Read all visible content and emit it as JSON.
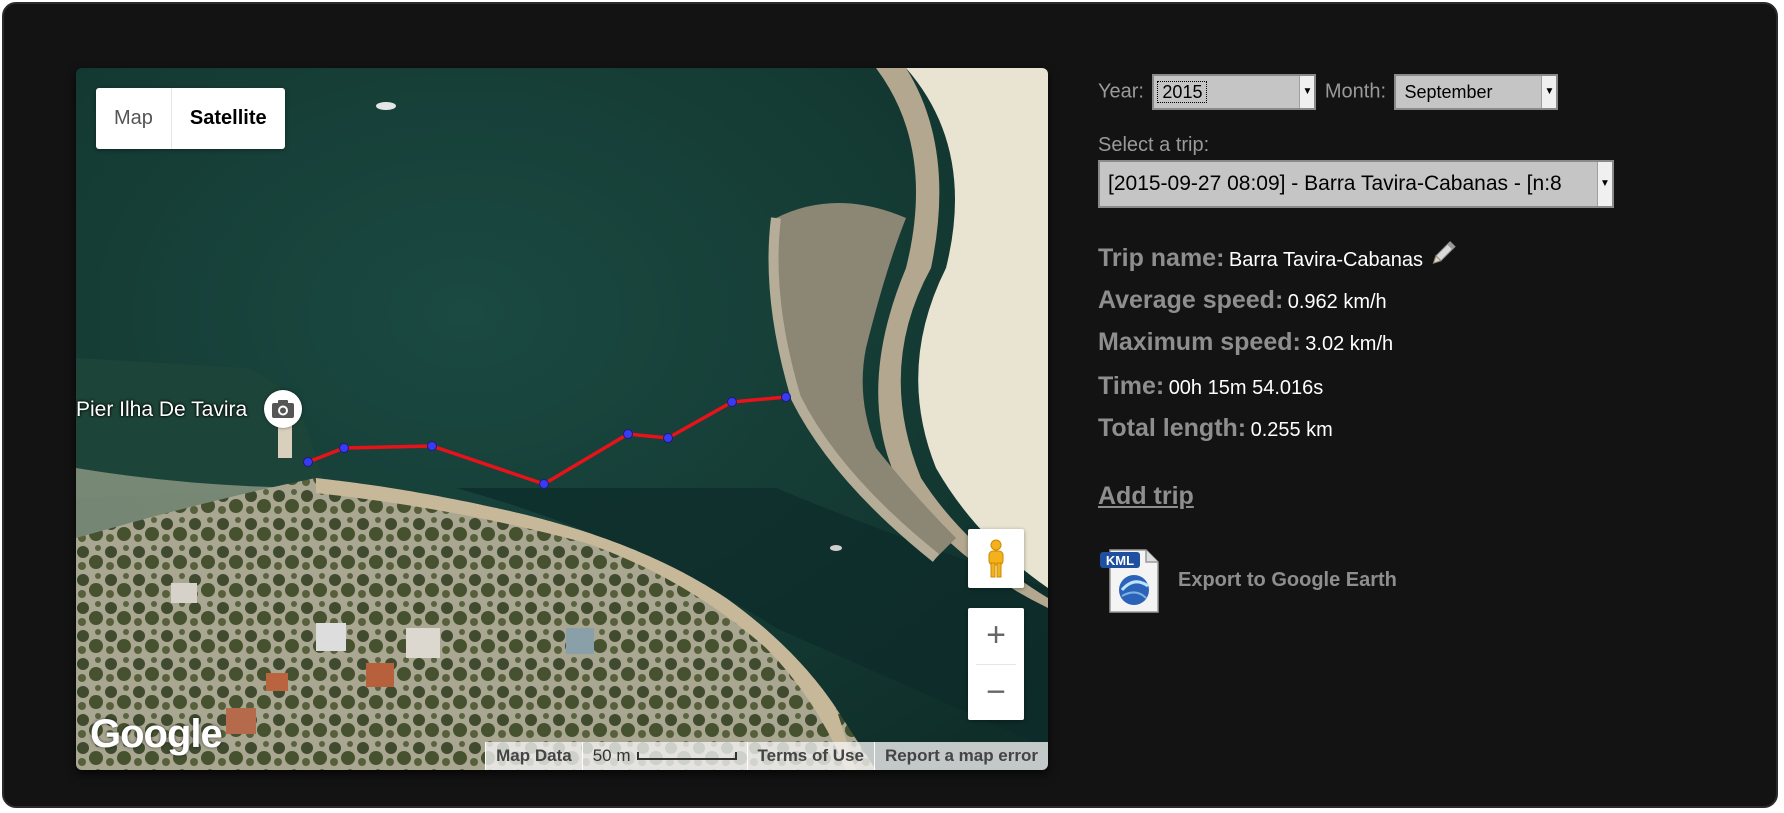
{
  "map": {
    "type_buttons": {
      "map": "Map",
      "satellite": "Satellite"
    },
    "place_label": "Pier Ilha De Tavira",
    "zoom": {
      "in": "+",
      "out": "−"
    },
    "logo": "Google",
    "attribution": {
      "map_data": "Map Data",
      "scale": "50 m",
      "terms": "Terms of Use",
      "report": "Report a map error"
    },
    "track_color": "#e8121a",
    "point_color": "#3a3af0"
  },
  "filters": {
    "year_label": "Year:",
    "year_value": "2015",
    "month_label": "Month:",
    "month_value": "September"
  },
  "trip_select": {
    "label": "Select a trip:",
    "value": "[2015-09-27 08:09] - Barra Tavira-Cabanas - [n:8"
  },
  "trip_info": {
    "name_label": "Trip name:",
    "name_value": "Barra Tavira-Cabanas",
    "avg_label": "Average speed:",
    "avg_value": "0.962 km/h",
    "max_label": "Maximum speed:",
    "max_value": "3.02 km/h",
    "time_label": "Time:",
    "time_value": "00h 15m 54.016s",
    "length_label": "Total length:",
    "length_value": "0.255 km"
  },
  "actions": {
    "add_trip": "Add trip",
    "kml_badge": "KML",
    "export": "Export to Google Earth"
  }
}
